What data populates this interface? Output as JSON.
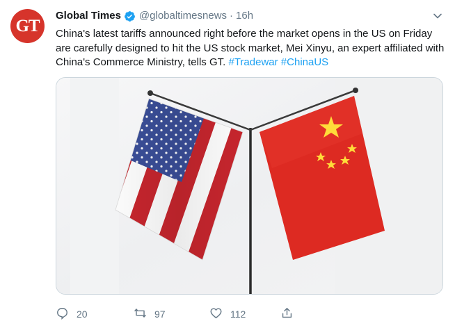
{
  "account": {
    "avatar_text": "GT",
    "display_name": "Global Times",
    "handle": "@globaltimesnews",
    "separator": "·",
    "time": "16h"
  },
  "tweet": {
    "text": "China's latest tariffs announced right before the market opens in the US on Friday are carefully designed to hit the US stock market, Mei Xinyu, an expert affiliated with China's Commerce Ministry, tells GT.",
    "hashtags": [
      "#Tradewar",
      "#ChinaUS"
    ]
  },
  "media": {
    "description_icon": "flags-photo"
  },
  "actions": {
    "reply_count": "20",
    "retweet_count": "97",
    "like_count": "112"
  },
  "colors": {
    "brand_red": "#d6342b",
    "link_blue": "#1da1f2",
    "muted_gray": "#657786"
  }
}
